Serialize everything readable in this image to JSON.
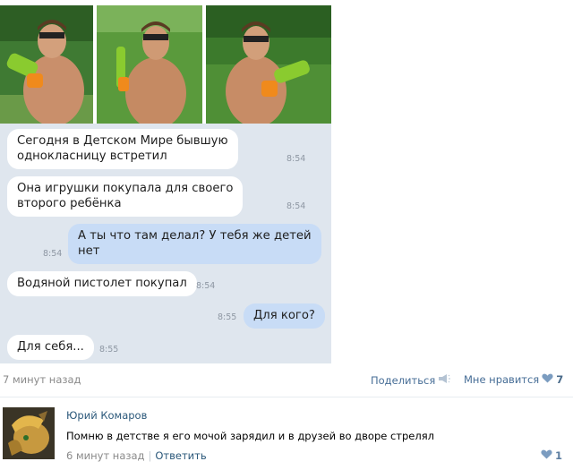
{
  "chat": {
    "messages": [
      {
        "side": "in",
        "text_lines": [
          "Сегодня в Детском Мире бывшую",
          "однокласницу встретил"
        ],
        "time": "8:54"
      },
      {
        "side": "in",
        "text_lines": [
          "Она игрушки покупала для своего",
          "второго ребёнка"
        ],
        "time": "8:54"
      },
      {
        "side": "out",
        "text_lines": [
          "А ты что там делал? У тебя же детей",
          "нет"
        ],
        "time": "8:54"
      },
      {
        "side": "in",
        "text_lines": [
          "Водяной пистолет покупал"
        ],
        "time": "8:54"
      },
      {
        "side": "out",
        "text_lines": [
          "Для кого?"
        ],
        "time": "8:55"
      },
      {
        "side": "in",
        "text_lines": [
          "Для себя..."
        ],
        "time": "8:55"
      }
    ]
  },
  "post": {
    "time": "7 минут назад",
    "share_label": "Поделиться",
    "like_label": "Мне нравится",
    "like_count": "7"
  },
  "comment": {
    "author": "Юрий Комаров",
    "text": "Помню в детстве я его мочой зарядил и в друзей во дворе стрелял",
    "time": "6 минут назад",
    "separator": "|",
    "reply_label": "Ответить",
    "like_count": "1"
  },
  "colors": {
    "chat_bg": "#dfe6ee",
    "bubble_in": "#ffffff",
    "bubble_out": "#c8dcf6",
    "link": "#2b587a"
  },
  "icons": [
    "share-icon",
    "heart-icon"
  ]
}
